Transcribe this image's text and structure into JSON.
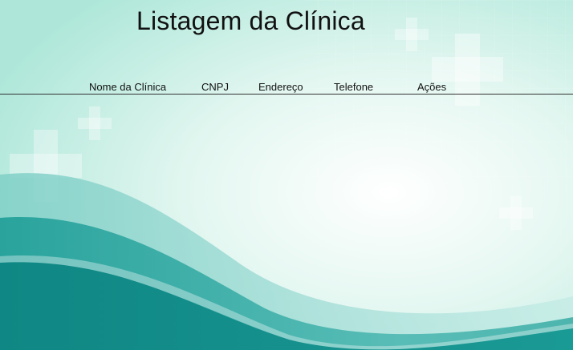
{
  "page": {
    "title": "Listagem da Clínica"
  },
  "table": {
    "columns": [
      {
        "key": "nome",
        "label": "Nome da Clínica"
      },
      {
        "key": "cnpj",
        "label": "CNPJ"
      },
      {
        "key": "endereco",
        "label": "Endereço"
      },
      {
        "key": "telefone",
        "label": "Telefone"
      },
      {
        "key": "acoes",
        "label": "Ações"
      }
    ],
    "rows": []
  },
  "theme": {
    "background_light": "#eefaf6",
    "background_mint": "#bfeee2",
    "wave_teal": "#1f9b96",
    "wave_dark": "#0e7f7c",
    "cross_color": "#ffffff"
  },
  "icons": [
    "medical-cross-icon"
  ]
}
